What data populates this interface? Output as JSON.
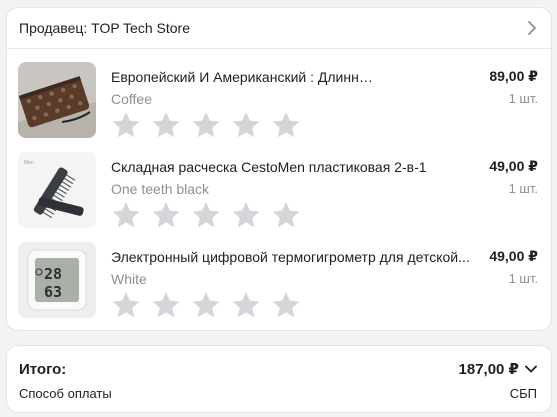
{
  "seller": {
    "label": "Продавец: TOP Tech Store",
    "icon": "chevron-right-icon"
  },
  "items": [
    {
      "title": "Европейский И Американский : Длинный...",
      "variant": "Coffee",
      "price": "89,00 ₽",
      "qty": "1 шт.",
      "rating": 0
    },
    {
      "title": "Складная расческа CestoMen пластиковая 2-в-1",
      "variant": "One teeth black",
      "price": "49,00 ₽",
      "qty": "1 шт.",
      "rating": 0
    },
    {
      "title": "Электронный цифровой термогигрометр для детской...",
      "variant": "White",
      "price": "49,00 ₽",
      "qty": "1 шт.",
      "rating": 0,
      "display": {
        "temp": "28",
        "hum": "63"
      }
    }
  ],
  "summary": {
    "total_label": "Итого:",
    "total_value": "187,00 ₽",
    "payment_label": "Способ оплаты",
    "payment_value": "СБП",
    "expand_icon": "chevron-down-icon"
  },
  "colors": {
    "star": "#d3d5d9",
    "muted_text": "#8c8f95",
    "page_bg": "#f2f3f5"
  }
}
